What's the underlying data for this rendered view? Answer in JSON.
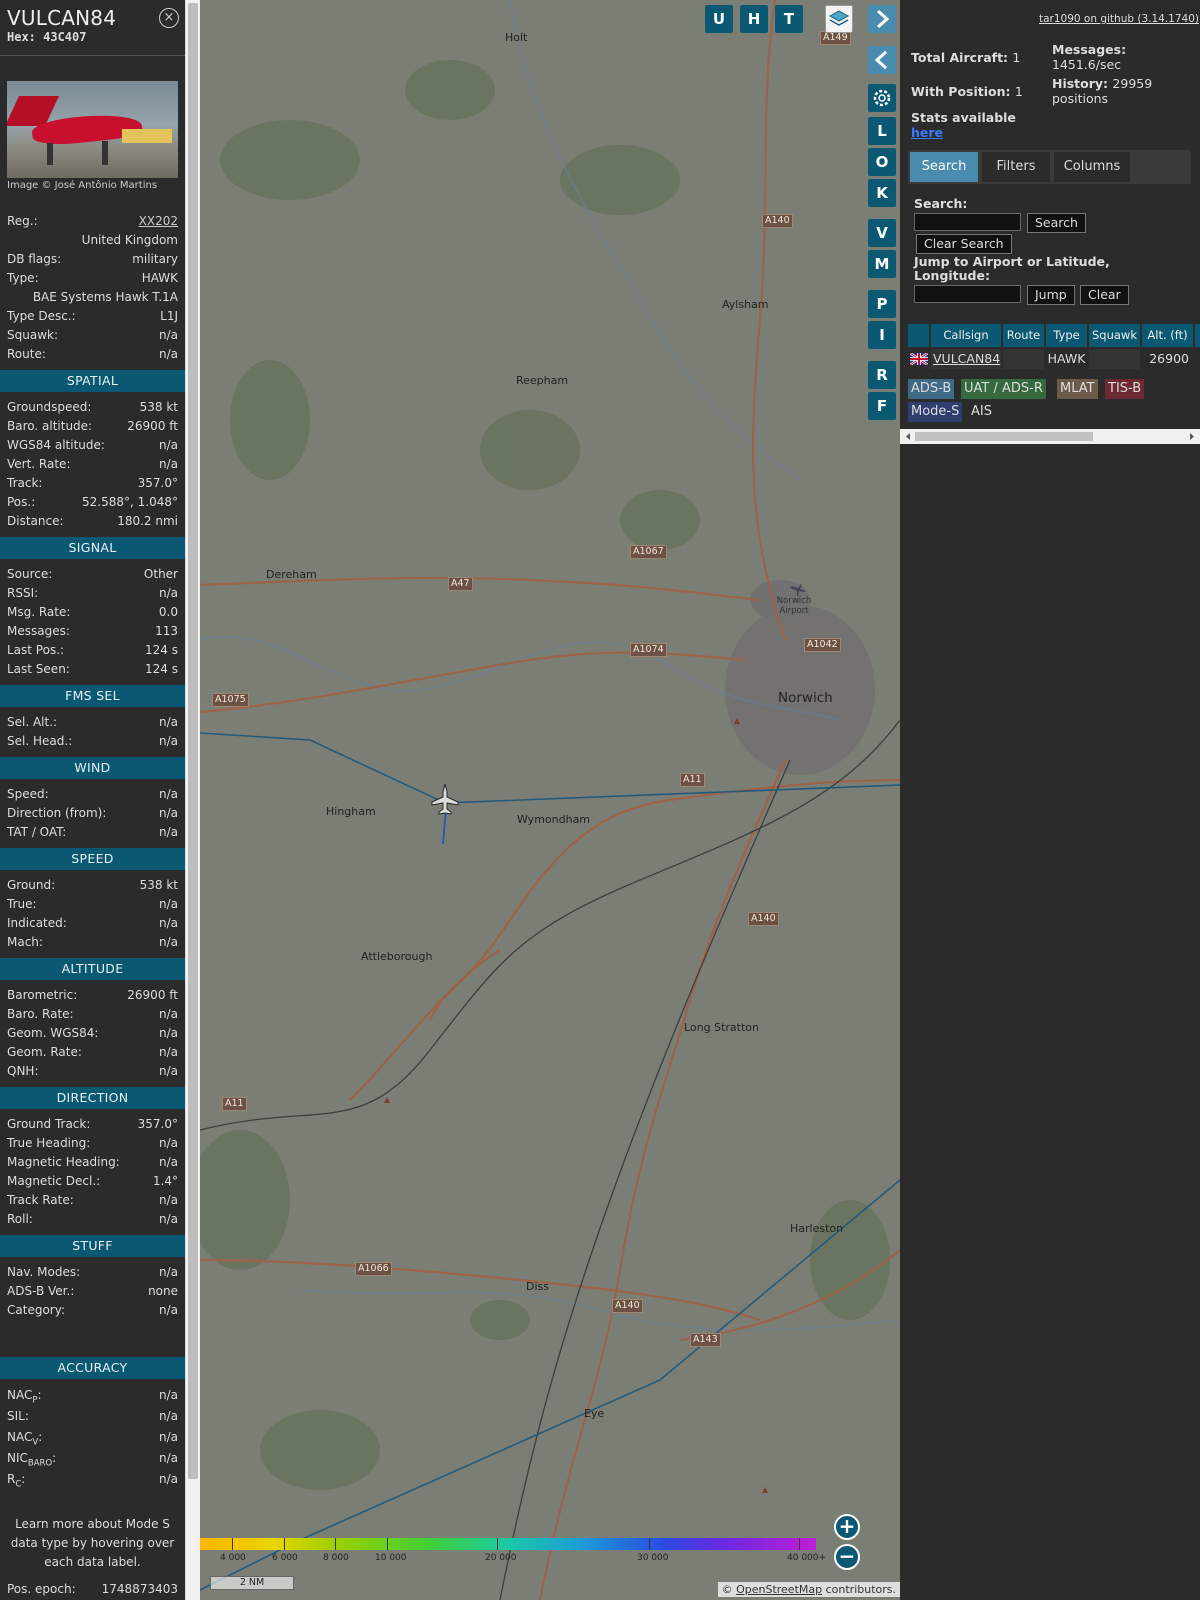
{
  "info": {
    "callsign": "VULCAN84",
    "hex": "Hex: 43C407",
    "close_glyph": "×",
    "photo_credit": "Image © José Antônio Martins",
    "aircraft": [
      {
        "label": "Reg.:",
        "value": "XX202"
      },
      {
        "label": "",
        "value": "United Kingdom"
      },
      {
        "label": "DB flags:",
        "value": "military"
      },
      {
        "label": "Type:",
        "value": "HAWK"
      },
      {
        "label": "",
        "value": "BAE Systems Hawk T.1A"
      },
      {
        "label": "Type Desc.:",
        "value": "L1J"
      },
      {
        "label": "Squawk:",
        "value": "n/a"
      },
      {
        "label": "Route:",
        "value": "n/a"
      }
    ],
    "sections": [
      {
        "title": "SPATIAL",
        "rows": [
          {
            "label": "Groundspeed:",
            "value": "538 kt"
          },
          {
            "label": "Baro. altitude:",
            "value": "26900 ft"
          },
          {
            "label": "WGS84 altitude:",
            "value": "n/a"
          },
          {
            "label": "Vert. Rate:",
            "value": "n/a"
          },
          {
            "label": "Track:",
            "value": "357.0°"
          },
          {
            "label": "Pos.:",
            "value": "52.588°, 1.048°"
          },
          {
            "label": "Distance:",
            "value": "180.2 nmi"
          }
        ]
      },
      {
        "title": "SIGNAL",
        "rows": [
          {
            "label": "Source:",
            "value": "Other"
          },
          {
            "label": "RSSI:",
            "value": "n/a"
          },
          {
            "label": "Msg. Rate:",
            "value": "0.0"
          },
          {
            "label": "Messages:",
            "value": "113"
          },
          {
            "label": "Last Pos.:",
            "value": "124 s"
          },
          {
            "label": "Last Seen:",
            "value": "124 s"
          }
        ]
      },
      {
        "title": "FMS SEL",
        "rows": [
          {
            "label": "Sel. Alt.:",
            "value": "n/a"
          },
          {
            "label": "Sel. Head.:",
            "value": "n/a"
          }
        ]
      },
      {
        "title": "WIND",
        "rows": [
          {
            "label": "Speed:",
            "value": "n/a"
          },
          {
            "label": "Direction (from):",
            "value": "n/a"
          },
          {
            "label": "TAT / OAT:",
            "value": "n/a"
          }
        ]
      },
      {
        "title": "SPEED",
        "rows": [
          {
            "label": "Ground:",
            "value": "538 kt"
          },
          {
            "label": "True:",
            "value": "n/a"
          },
          {
            "label": "Indicated:",
            "value": "n/a"
          },
          {
            "label": "Mach:",
            "value": "n/a"
          }
        ]
      },
      {
        "title": "ALTITUDE",
        "rows": [
          {
            "label": "Barometric:",
            "value": "26900 ft"
          },
          {
            "label": "Baro. Rate:",
            "value": "n/a"
          },
          {
            "label": "Geom. WGS84:",
            "value": "n/a"
          },
          {
            "label": "Geom. Rate:",
            "value": "n/a"
          },
          {
            "label": "QNH:",
            "value": "n/a"
          }
        ]
      },
      {
        "title": "DIRECTION",
        "rows": [
          {
            "label": "Ground Track:",
            "value": "357.0°"
          },
          {
            "label": "True Heading:",
            "value": "n/a"
          },
          {
            "label": "Magnetic Heading:",
            "value": "n/a"
          },
          {
            "label": "Magnetic Decl.:",
            "value": "1.4°"
          },
          {
            "label": "Track Rate:",
            "value": "n/a"
          },
          {
            "label": "Roll:",
            "value": "n/a"
          }
        ]
      },
      {
        "title": "STUFF",
        "rows": [
          {
            "label": "Nav. Modes:",
            "value": "n/a"
          },
          {
            "label": "ADS-B Ver.:",
            "value": "none"
          },
          {
            "label": "Category:",
            "value": "n/a"
          }
        ]
      }
    ],
    "accuracy": {
      "title": "ACCURACY",
      "rows": [
        {
          "label": "NAC",
          "sub": "P",
          "value": "n/a"
        },
        {
          "label": "SIL",
          "sub": "",
          "value": "n/a"
        },
        {
          "label": "NAC",
          "sub": "V",
          "value": "n/a"
        },
        {
          "label": "NIC",
          "sub": "BARO",
          "value": "n/a"
        },
        {
          "label": "R",
          "sub": "C",
          "value": "n/a"
        }
      ]
    },
    "learn_more": "Learn more about Mode S data type by hovering over each data label.",
    "epoch_label": "Pos. epoch:",
    "epoch_value": "1748873403"
  },
  "map": {
    "buttons_top": [
      "U",
      "H",
      "T"
    ],
    "buttons_side": [
      "L",
      "O",
      "K",
      "V",
      "M",
      "P",
      "I",
      "R",
      "F"
    ],
    "places": [
      "Holt",
      "Aylsham",
      "Reepham",
      "Dereham",
      "Norwich",
      "Norwich Airport",
      "Hingham",
      "Wymondham",
      "Attleborough",
      "Long Stratton",
      "Harleston",
      "Diss",
      "Eye"
    ],
    "roads": [
      "A149",
      "A140",
      "A1067",
      "A47",
      "A1074",
      "A1042",
      "A1075",
      "A11",
      "A140",
      "A11",
      "A1066",
      "A140",
      "A143"
    ],
    "colorbar_labels": [
      "4 000",
      "6 000",
      "8 000",
      "10 000",
      "20 000",
      "30 000",
      "40 000+"
    ],
    "scale": "2 NM",
    "attribution_prefix": "© ",
    "attribution_link": "OpenStreetMap",
    "attribution_suffix": " contributors."
  },
  "side": {
    "github": "tar1090 on github (3.14.1740)",
    "total_label": "Total Aircraft:",
    "total_value": "1",
    "position_label": "With Position:",
    "position_value": "1",
    "stats_text": "Stats available",
    "stats_link": "here",
    "messages_label": "Messages:",
    "messages_value": "1451.6/sec",
    "history_label": "History:",
    "history_value": "29959 positions",
    "tabs": [
      "Search",
      "Filters",
      "Columns"
    ],
    "search_label": "Search:",
    "search_button": "Search",
    "clear_search_button": "Clear Search",
    "jump_label": "Jump to Airport or Latitude, Longitude:",
    "jump_button": "Jump",
    "clear_button": "Clear",
    "columns": [
      "Callsign",
      "Route",
      "Type",
      "Squawk",
      "Alt. (ft)"
    ],
    "rows": [
      {
        "callsign": "VULCAN84",
        "route": "",
        "type": "HAWK",
        "squawk": "",
        "alt": "26900"
      }
    ],
    "source_tags": [
      "ADS-B",
      "UAT / ADS-R",
      "MLAT",
      "TIS-B",
      "Mode-S",
      "AIS"
    ]
  }
}
